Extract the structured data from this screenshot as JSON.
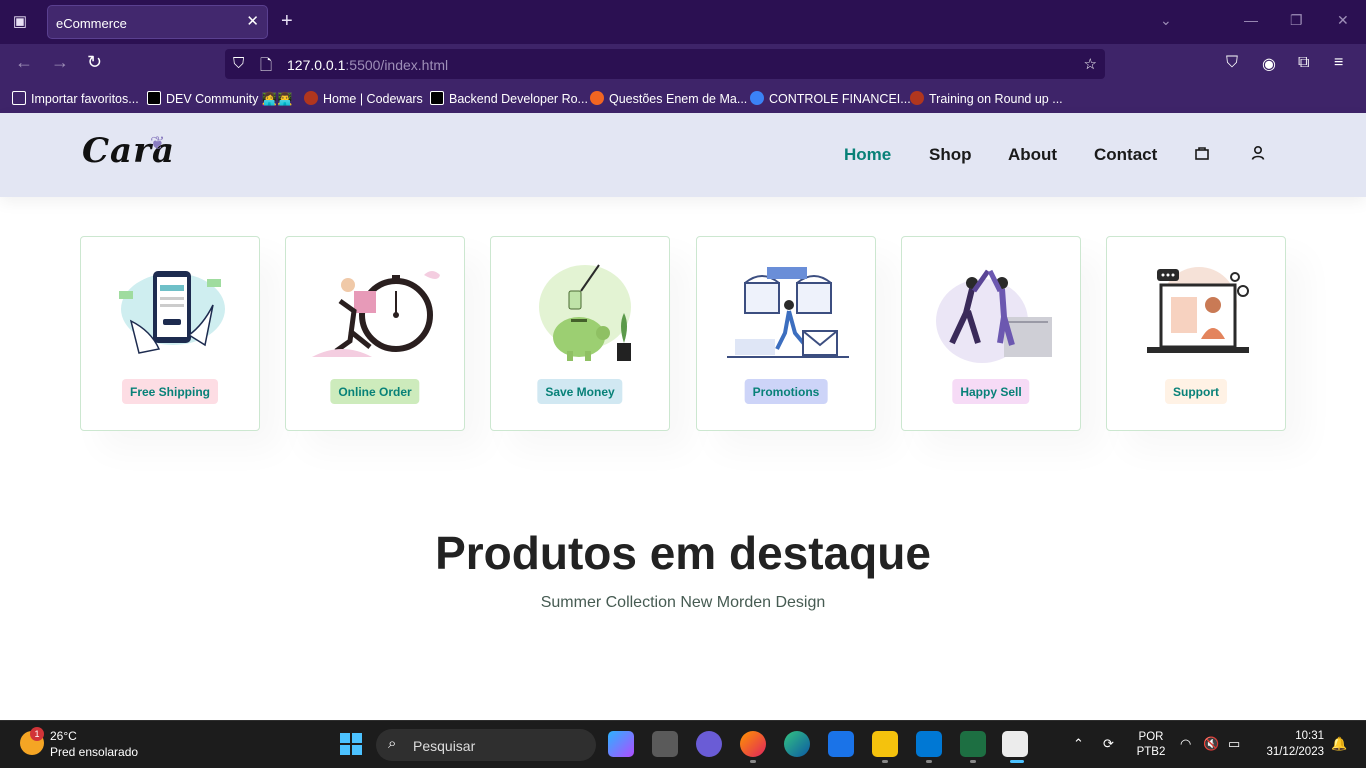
{
  "browser": {
    "tab_title": "eCommerce",
    "tab_close": "✕",
    "new_tab": "+",
    "url_host": "127.0.0.1",
    "url_rest": ":5500/index.html",
    "bookmarks": [
      {
        "label": "Importar favoritos...",
        "color": "#ffffff"
      },
      {
        "label": "DEV Community 👩‍💻👨‍💻",
        "color": "#000000"
      },
      {
        "label": "Home | Codewars",
        "color": "#b1361e"
      },
      {
        "label": "Backend Developer Ro...",
        "color": "#000000"
      },
      {
        "label": "Questões Enem de Ma...",
        "color": "#f26522"
      },
      {
        "label": "CONTROLE FINANCEI...",
        "color": "#3b82f6"
      },
      {
        "label": "Training on Round up ...",
        "color": "#b1361e"
      }
    ]
  },
  "site": {
    "logo": "Cara",
    "menu": [
      {
        "label": "Home",
        "active": true
      },
      {
        "label": "Shop",
        "active": false
      },
      {
        "label": "About",
        "active": false
      },
      {
        "label": "Contact",
        "active": false
      }
    ],
    "accent_color": "#088178",
    "features": [
      {
        "label": "Free Shipping",
        "bg": "#fddde4",
        "icon": "phone-payment-illustration"
      },
      {
        "label": "Online Order",
        "bg": "#cdebbc",
        "icon": "delivery-clock-illustration"
      },
      {
        "label": "Save Money",
        "bg": "#d1e8f2",
        "icon": "piggy-bank-illustration"
      },
      {
        "label": "Promotions",
        "bg": "#cdd4f8",
        "icon": "promotions-illustration"
      },
      {
        "label": "Happy Sell",
        "bg": "#f6dbf6",
        "icon": "high-five-illustration"
      },
      {
        "label": "Support",
        "bg": "#fff2e5",
        "icon": "support-laptop-illustration"
      }
    ],
    "section_title": "Produtos em destaque",
    "section_subtitle": "Summer Collection New Morden Design"
  },
  "taskbar": {
    "weather_temp": "26°C",
    "weather_desc": "Pred ensolarado",
    "weather_badge": "1",
    "search_placeholder": "Pesquisar",
    "lang_top": "POR",
    "lang_bottom": "PTB2",
    "time": "10:31",
    "date": "31/12/2023"
  }
}
